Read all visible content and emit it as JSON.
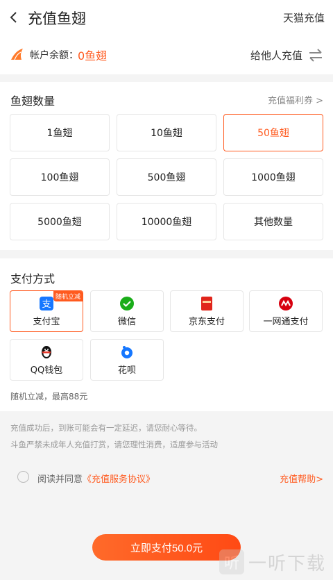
{
  "header": {
    "title": "充值鱼翅",
    "tmall_link": "天猫充值"
  },
  "balance": {
    "label": "帐户余额：",
    "value": "0鱼翅",
    "other_recharge": "给他人充值"
  },
  "amount_section": {
    "title": "鱼翅数量",
    "coupon_link": "充值福利券 >",
    "options": [
      "1鱼翅",
      "10鱼翅",
      "50鱼翅",
      "100鱼翅",
      "500鱼翅",
      "1000鱼翅",
      "5000鱼翅",
      "10000鱼翅",
      "其他数量"
    ],
    "selected_index": 2
  },
  "payment_section": {
    "title": "支付方式",
    "methods": [
      {
        "label": "支付宝",
        "icon": "alipay-icon",
        "color": "#1677ff",
        "tag": "随机立减"
      },
      {
        "label": "微信",
        "icon": "wechat-icon",
        "color": "#1aad19"
      },
      {
        "label": "京东支付",
        "icon": "jdpay-icon",
        "color": "#e1251b"
      },
      {
        "label": "一网通支付",
        "icon": "cmb-icon",
        "color": "#d7000f"
      },
      {
        "label": "QQ钱包",
        "icon": "qq-penguin-icon",
        "color": "#000000"
      },
      {
        "label": "花呗",
        "icon": "huabei-icon",
        "color": "#1677ff"
      }
    ],
    "selected_index": 0,
    "note": "随机立减，最高88元"
  },
  "notes": {
    "line1": "充值成功后，到账可能会有一定延迟，请您耐心等待。",
    "line2": "斗鱼严禁未成年人充值打赏，请您理性消费，适度参与活动"
  },
  "agreement": {
    "prefix": "阅读并同意",
    "link": "《充值服务协议》",
    "help": "充值帮助>"
  },
  "pay_button": "立即支付50.0元",
  "watermark": {
    "text": "一听下载"
  },
  "colors": {
    "accent": "#ff5a1f"
  }
}
